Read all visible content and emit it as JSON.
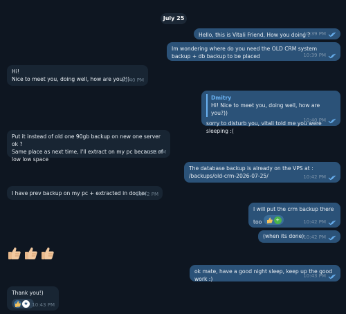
{
  "date_label": "July 25",
  "messages": [
    {
      "text": "Hello, this is Vitali Friend, How you doing ?",
      "time": "10:39 PM"
    },
    {
      "text": "Im wondering where do you need the OLD CRM system backup + db backup to be placed",
      "time": "10:39 PM"
    },
    {
      "text": "Hi!\nNice to meet you, doing well, how are you?))",
      "time": "10:40 PM"
    },
    {
      "quote_name": "Dmitry",
      "quote_text": "Hi! Nice to meet you, doing well, how are you?))",
      "text": "sorry to disturb you, vitali told me you were sleeping :(",
      "time": "10:40 PM"
    },
    {
      "text": "Put it instead of old one 90gb backup on new one server ok ?\nSame place as next time, I'll extract on my pc because of low low space",
      "time": "10:41 PM"
    },
    {
      "text": "The database backup is already on the VPS at : /backups/old-crm-2026-07-25/",
      "time": "10:42 PM"
    },
    {
      "text": "I have prev backup on my pc + extracted in docker",
      "time": "10:42 PM"
    },
    {
      "text": "I will put the crm backup there too",
      "time": "10:42 PM",
      "reactions": [
        "thumbs-up",
        "green-circle"
      ]
    },
    {
      "text": "(when its done)",
      "time": "10:42 PM"
    },
    {
      "sticker": [
        "thumbs-up",
        "thumbs-up",
        "thumbs-up"
      ]
    },
    {
      "text": "ok mate, have a good night sleep, keep up the good work :)",
      "time": "10:43 PM"
    },
    {
      "text": "Thank you!)",
      "time": "10:43 PM",
      "reactions": [
        "thumbs-up",
        "star-badge"
      ]
    }
  ],
  "colors": {
    "background": "#0e1621",
    "outgoing": "#2b5278",
    "incoming": "#182533",
    "accent": "#6ab2f2"
  }
}
